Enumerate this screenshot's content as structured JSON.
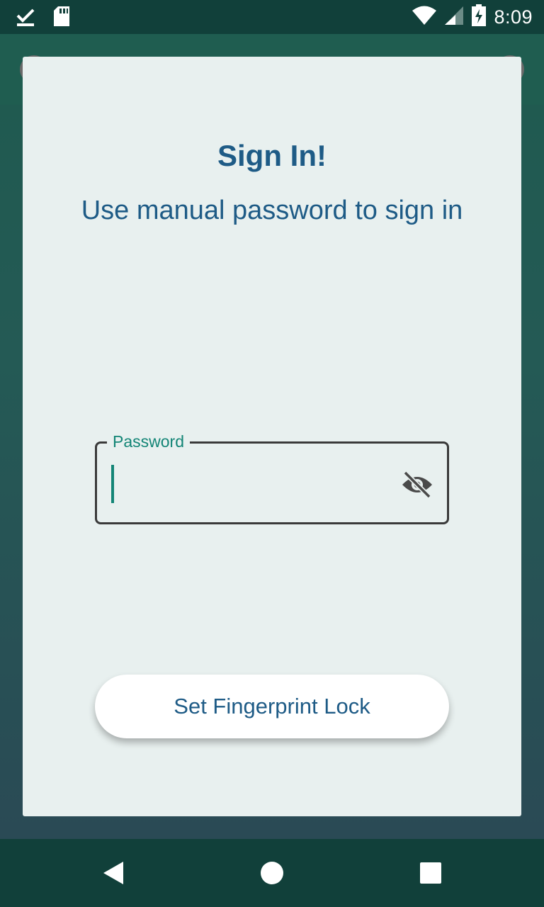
{
  "status_bar": {
    "time": "8:09",
    "icons": [
      "download-done-icon",
      "sd-card-icon",
      "wifi-icon",
      "signal-icon",
      "battery-charging-icon"
    ]
  },
  "dialog": {
    "title": "Sign In!",
    "subtitle": "Use manual password to sign in",
    "password_field": {
      "label": "Password",
      "value": "",
      "visibility_icon": "eye-off-icon"
    },
    "button_label": "Set Fingerprint Lock"
  },
  "navigation": {
    "icons": [
      "back-icon",
      "home-icon",
      "recents-icon"
    ]
  },
  "colors": {
    "accent": "#138576",
    "text_primary": "#1e5b86",
    "status_bar": "#11403a",
    "dialog_bg": "#e8f0ef"
  }
}
